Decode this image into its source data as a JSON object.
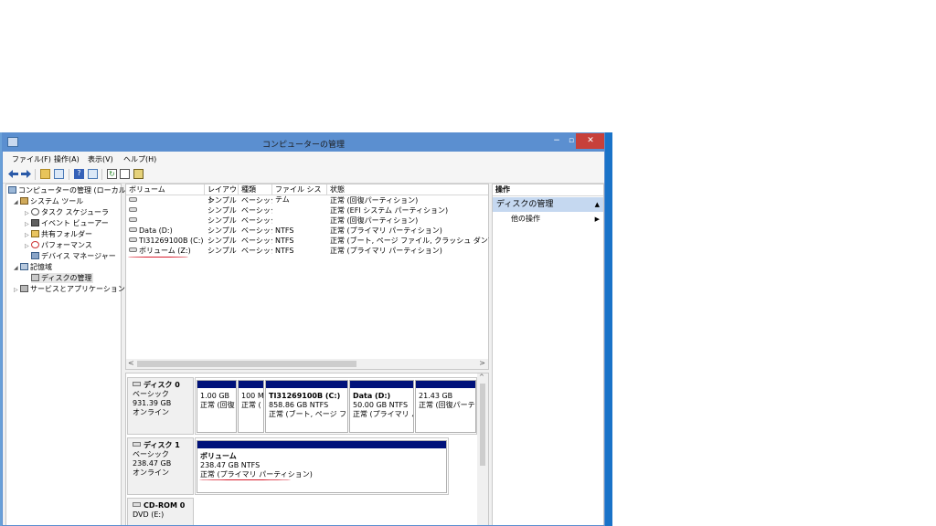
{
  "window": {
    "title": "コンピューターの管理",
    "controls": {
      "minimize": "−",
      "maximize": "▫",
      "close": "✕"
    }
  },
  "menu": [
    "ファイル(F)",
    "操作(A)",
    "表示(V)",
    "ヘルプ(H)"
  ],
  "toolbar": {
    "help_label": "?",
    "refresh_label": "↻"
  },
  "tree": [
    {
      "label": "コンピューターの管理 (ローカル)",
      "icon": "computer-icon",
      "expander": "",
      "level": 0
    },
    {
      "label": "システム ツール",
      "icon": "tools-icon",
      "expander": "◢",
      "level": 1
    },
    {
      "label": "タスク スケジューラ",
      "icon": "clock-icon",
      "expander": "▷",
      "level": 2
    },
    {
      "label": "イベント ビューアー",
      "icon": "event-viewer-icon",
      "expander": "▷",
      "level": 2
    },
    {
      "label": "共有フォルダー",
      "icon": "shared-folder-icon",
      "expander": "▷",
      "level": 2
    },
    {
      "label": "パフォーマンス",
      "icon": "performance-icon",
      "expander": "▷",
      "level": 2
    },
    {
      "label": "デバイス マネージャー",
      "icon": "device-manager-icon",
      "expander": "",
      "level": 2
    },
    {
      "label": "記憶域",
      "icon": "storage-icon",
      "expander": "◢",
      "level": 1
    },
    {
      "label": "ディスクの管理",
      "icon": "disk-management-icon",
      "expander": "",
      "level": 2,
      "selected": true
    },
    {
      "label": "サービスとアプリケーション",
      "icon": "services-icon",
      "expander": "▷",
      "level": 1
    }
  ],
  "volumes": {
    "columns": [
      "ボリューム",
      "レイアウト",
      "種類",
      "ファイル システム",
      "状態"
    ],
    "rows": [
      {
        "name": "",
        "layout": "シンプル",
        "type": "ベーシック",
        "fs": "",
        "status": "正常 (回復パーティション)"
      },
      {
        "name": "",
        "layout": "シンプル",
        "type": "ベーシック",
        "fs": "",
        "status": "正常 (EFI システム パーティション)"
      },
      {
        "name": "",
        "layout": "シンプル",
        "type": "ベーシック",
        "fs": "",
        "status": "正常 (回復パーティション)"
      },
      {
        "name": "Data (D:)",
        "layout": "シンプル",
        "type": "ベーシック",
        "fs": "NTFS",
        "status": "正常 (プライマリ パーティション)"
      },
      {
        "name": "TI31269100B (C:)",
        "layout": "シンプル",
        "type": "ベーシック",
        "fs": "NTFS",
        "status": "正常 (ブート, ページ ファイル, クラッシュ ダンプ, プライマ"
      },
      {
        "name": "ボリューム (Z:)",
        "layout": "シンプル",
        "type": "ベーシック",
        "fs": "NTFS",
        "status": "正常 (プライマリ パーティション)"
      }
    ]
  },
  "scroll": {
    "left": "<",
    "right": ">",
    "up": "^"
  },
  "disks": [
    {
      "name": "ディスク 0",
      "type": "ベーシック",
      "size": "931.39 GB",
      "state": "オンライン",
      "partitions": [
        {
          "name": "",
          "size": "1.00 GB",
          "status": "正常 (回復"
        },
        {
          "name": "",
          "size": "100 M",
          "status": "正常 ("
        },
        {
          "name": "TI31269100B  (C:)",
          "size": "858.86 GB NTFS",
          "status": "正常 (ブート, ページ ファ"
        },
        {
          "name": "Data  (D:)",
          "size": "50.00 GB NTFS",
          "status": "正常 (プライマリ パ"
        },
        {
          "name": "",
          "size": "21.43 GB",
          "status": "正常 (回復パーテ"
        }
      ]
    },
    {
      "name": "ディスク 1",
      "type": "ベーシック",
      "size": "238.47 GB",
      "state": "オンライン",
      "partitions": [
        {
          "name": "ボリューム",
          "size": "238.47 GB NTFS",
          "status": "正常 (プライマリ パーティション)"
        }
      ]
    },
    {
      "name": "CD-ROM 0",
      "type": "DVD (E:)"
    }
  ],
  "actions": {
    "header": "操作",
    "section": "ディスクの管理",
    "section_caret": "▲",
    "items": [
      {
        "label": "他の操作",
        "arrow": "▶"
      }
    ]
  },
  "colors": {
    "titlebar": "#5b8fd0",
    "partition_band": "#00127a",
    "annotation": "#d81e2e",
    "close": "#c7403a",
    "actions_section": "#c5d8f0"
  }
}
